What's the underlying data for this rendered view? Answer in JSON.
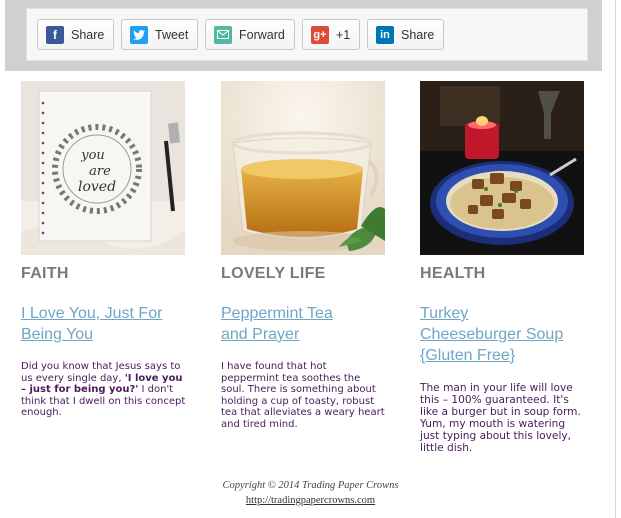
{
  "share_bar": {
    "buttons": [
      {
        "label": "Share",
        "icon": "facebook-icon",
        "color": "#3b5998"
      },
      {
        "label": "Tweet",
        "icon": "twitter-icon",
        "color": "#1da1f2"
      },
      {
        "label": "Forward",
        "icon": "envelope-icon",
        "color": "#4eb8a0"
      },
      {
        "label": "+1",
        "icon": "google-plus-icon",
        "color": "#dd4b39"
      },
      {
        "label": "Share",
        "icon": "linkedin-icon",
        "color": "#0077b5"
      }
    ]
  },
  "columns": [
    {
      "image": "notebook-you-are-loved",
      "category": "FAITH",
      "title_line1": "I Love You, Just For",
      "title_line2": "Being You",
      "blurb_pre": "Did you know that Jesus says to us every single day, ",
      "blurb_bold": "'I love you – just for being you?'",
      "blurb_post": " I don't think that I dwell on this concept enough."
    },
    {
      "image": "peppermint-tea-cup",
      "category": "LOVELY LIFE",
      "title_line1": "Peppermint Tea",
      "title_line2": "and Prayer",
      "blurb": "I have found that hot peppermint tea soothes the soul. There is something about holding a cup of toasty, robust tea that alleviates a weary heart and tired mind."
    },
    {
      "image": "turkey-soup-bowl",
      "category": "HEALTH",
      "title_line1": "Turkey",
      "title_line2": "Cheeseburger Soup",
      "title_line3": "{Gluten Free}",
      "blurb": "The man in your life will love this – 100% guaranteed. It's like a burger but in soup form. Yum, my mouth is watering just typing about this lovely, little dish."
    }
  ],
  "footer": {
    "copyright": "Copyright © 2014 Trading Paper Crowns",
    "url": "http://tradingpapercrowns.com"
  }
}
